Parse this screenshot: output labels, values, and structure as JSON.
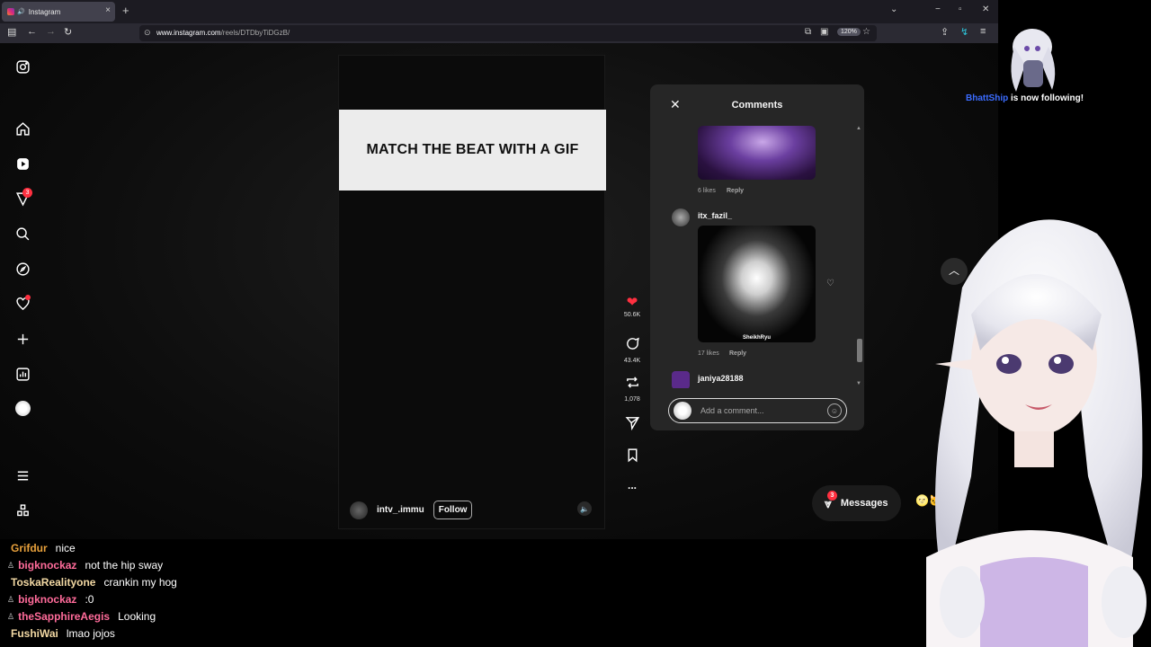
{
  "browser": {
    "tab_title": "Instagram",
    "tab_speaker": "🔊",
    "new_tab": "+",
    "url_domain": "www.instagram.com",
    "url_path": "/reels/DTDbyTiDGzB/",
    "zoom": "120%",
    "win_min": "−",
    "win_max": "▫",
    "win_close": "✕",
    "tab_list": "⌄"
  },
  "sidebar": {
    "notifications_badge": "3"
  },
  "reel": {
    "banner_text": "MATCH THE BEAT WITH A GIF",
    "username": "intv_.immu",
    "follow_label": "Follow",
    "mute_icon": "🔈"
  },
  "actions": {
    "likes": "50.6K",
    "comments": "43.4K",
    "reposts": "1,078",
    "more": "..."
  },
  "comments": {
    "title": "Comments",
    "items": [
      {
        "likes": "6 likes",
        "reply": "Reply"
      },
      {
        "user": "itx_fazil_",
        "gif_watermark": "SheikhRyu",
        "likes": "17 likes",
        "reply": "Reply"
      },
      {
        "user": "janiya28188"
      }
    ],
    "placeholder": "Add a comment..."
  },
  "messages": {
    "label": "Messages",
    "badge": "3"
  },
  "chat": [
    {
      "name": "Grifdur",
      "msg": "nice",
      "color": "#e8a13c",
      "badge": ""
    },
    {
      "name": "bigknockaz",
      "msg": "not the hip sway",
      "color": "#ff6b9a",
      "badge": "♙"
    },
    {
      "name": "ToskaRealityone",
      "msg": "crankin my hog",
      "color": "#f3d9a4",
      "badge": ""
    },
    {
      "name": "bigknockaz",
      "msg": ":0",
      "color": "#ff6b9a",
      "badge": "♙"
    },
    {
      "name": "theSapphireAegis",
      "msg": "Looking",
      "color": "#ff6b9a",
      "badge": "♙"
    },
    {
      "name": "FushiWai",
      "msg": "lmao jojos",
      "color": "#f3d9a4",
      "badge": ""
    }
  ],
  "stream": {
    "follower_name": "BhattShip",
    "follow_text": "is now following!"
  }
}
